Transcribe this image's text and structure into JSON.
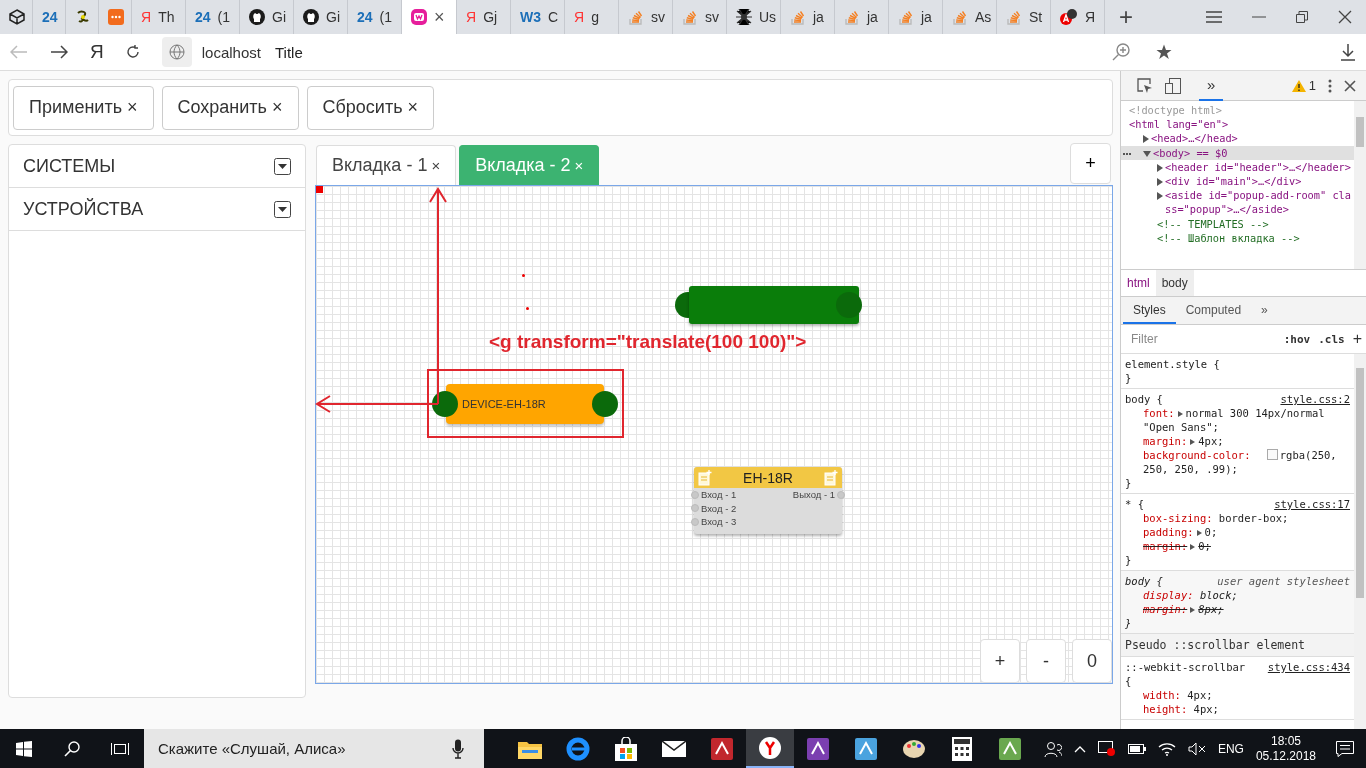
{
  "browser": {
    "tabs": [
      {
        "kind": "cube",
        "selected": false
      },
      {
        "kind": "logo",
        "logo": "24",
        "selected": false
      },
      {
        "kind": "bolt",
        "selected": false
      },
      {
        "kind": "dots",
        "selected": false
      },
      {
        "kind": "logo-red",
        "logo": "Я",
        "title": "Th",
        "selected": false
      },
      {
        "kind": "logo",
        "logo": "24",
        "title": "(1",
        "selected": false
      },
      {
        "kind": "github",
        "title": "Gi",
        "selected": false
      },
      {
        "kind": "github",
        "title": "Gi",
        "selected": false
      },
      {
        "kind": "logo",
        "logo": "24",
        "title": "(1",
        "selected": false
      },
      {
        "kind": "pink",
        "close": "×",
        "selected": true
      },
      {
        "kind": "logo-red",
        "logo": "Я",
        "title": "Gj",
        "selected": false
      },
      {
        "kind": "logo",
        "logo": "W3",
        "title": "C",
        "selected": false
      },
      {
        "kind": "logo-red",
        "logo": "Я",
        "title": "g",
        "selected": false
      },
      {
        "kind": "stack",
        "title": "sv",
        "selected": false
      },
      {
        "kind": "stack",
        "title": "sv",
        "selected": false
      },
      {
        "kind": "spider",
        "title": "Us",
        "selected": false
      },
      {
        "kind": "stack",
        "title": "ja",
        "selected": false
      },
      {
        "kind": "stack",
        "title": "ja",
        "selected": false
      },
      {
        "kind": "stack",
        "title": "ja",
        "selected": false
      },
      {
        "kind": "stack",
        "title": "As",
        "selected": false
      },
      {
        "kind": "stack",
        "title": "St",
        "selected": false
      },
      {
        "kind": "badge",
        "title": "Я",
        "selected": false
      }
    ],
    "new_tab": "+",
    "home": "Я",
    "address": {
      "host": "localhost",
      "title": "Title"
    }
  },
  "app": {
    "toolbar": [
      {
        "label": "Применить",
        "close": "×"
      },
      {
        "label": "Сохранить",
        "close": "×"
      },
      {
        "label": "Сбросить",
        "close": "×"
      }
    ],
    "sidebar": [
      {
        "label": "СИСТЕМЫ",
        "expanded": false
      },
      {
        "label": "УСТРОЙСТВА",
        "expanded": false
      }
    ],
    "tabs": [
      {
        "label": "Вкладка - 1",
        "close": "×",
        "selected": false
      },
      {
        "label": "Вкладка - 2",
        "close": "×",
        "selected": true
      }
    ],
    "add_tab": "+",
    "canvas": {
      "annotation": "<g transform=\"translate(100 100)\">",
      "device_node": "DEVICE-EH-18R",
      "block": {
        "title": "EH-18R",
        "inputs": [
          "Вход - 1",
          "Вход - 2",
          "Вход - 3"
        ],
        "outputs": [
          "Выход - 1"
        ]
      }
    },
    "zoom_buttons": [
      "+",
      "-",
      "0"
    ]
  },
  "devtools": {
    "panel_tab": "»",
    "warnings": "1",
    "tree": [
      {
        "text": "<!doctype html>",
        "kind": "doctype"
      },
      {
        "text": "<html lang=\"en\">",
        "kind": "tag",
        "children": [
          {
            "text": "<head>…</head>",
            "kind": "tag",
            "expanded": false,
            "selected": false
          },
          {
            "text": "<body> == $0",
            "kind": "tag",
            "expanded": true,
            "selected": true,
            "children": [
              {
                "text": "<header id=\"header\">…</header>",
                "kind": "tag",
                "expanded": false,
                "selected": false
              },
              {
                "text": "<div id=\"main\">…</div>",
                "kind": "tag",
                "expanded": false,
                "selected": false
              },
              {
                "text": "<aside id=\"popup-add-room\" class=\"popup\">…</aside>",
                "kind": "tag",
                "expanded": false,
                "selected": false
              },
              {
                "text": "<!-- TEMPLATES -->",
                "kind": "comment"
              },
              {
                "text": "<!-- Шаблон вкладка -->",
                "kind": "comment"
              }
            ]
          }
        ]
      }
    ],
    "breadcrumbs": [
      {
        "label": "html",
        "selected": false
      },
      {
        "label": "body",
        "selected": true
      }
    ],
    "style_tabs": [
      {
        "label": "Styles",
        "selected": true
      },
      {
        "label": "Computed",
        "selected": false
      },
      {
        "label": "»",
        "selected": false
      }
    ],
    "filter": {
      "placeholder": "Filter"
    },
    "hov": ":hov",
    "cls": ".cls",
    "add_rule": "+",
    "rules": [
      {
        "kind": "inline",
        "selector": "element.style {",
        "close": "}"
      },
      {
        "kind": "author",
        "selector": "body {",
        "source": "style.css:2",
        "close": "}",
        "declarations": [
          {
            "kind": "plain",
            "property": "font:",
            "value": "normal 300 14px/normal \"Open Sans\";",
            "expandable": true,
            "struck": false
          },
          {
            "kind": "plain",
            "property": "margin:",
            "value": "4px;",
            "expandable": true,
            "struck": false
          },
          {
            "kind": "color",
            "property": "background-color:",
            "value": "rgba(250, 250, 250, .99);",
            "expandable": false,
            "struck": false
          }
        ]
      },
      {
        "kind": "author",
        "selector": "* {",
        "source": "style.css:17",
        "close": "}",
        "declarations": [
          {
            "kind": "plain",
            "property": "box-sizing:",
            "value": "border-box;",
            "expandable": false,
            "struck": false
          },
          {
            "kind": "plain",
            "property": "padding:",
            "value": "0;",
            "expandable": true,
            "struck": false
          },
          {
            "kind": "plain",
            "property": "margin:",
            "value": "0;",
            "expandable": true,
            "struck": true
          }
        ]
      },
      {
        "kind": "agent",
        "selector": "body {",
        "source": "user agent stylesheet",
        "close": "}",
        "declarations": [
          {
            "kind": "plain",
            "property": "display:",
            "value": "block;",
            "expandable": false,
            "struck": false
          },
          {
            "kind": "plain",
            "property": "margin:",
            "value": "8px;",
            "expandable": true,
            "struck": true
          }
        ]
      },
      {
        "kind": "header",
        "selector": "Pseudo ::scrollbar element"
      },
      {
        "kind": "author",
        "selector": "::-webkit-scrollbar",
        "source": "style.css:434",
        "brace_line": "{",
        "declarations": [
          {
            "kind": "plain",
            "property": "width:",
            "value": "4px;",
            "expandable": false,
            "struck": false
          },
          {
            "kind": "plain",
            "property": "height:",
            "value": "4px;",
            "expandable": false,
            "struck": false
          }
        ]
      }
    ]
  },
  "taskbar": {
    "search_placeholder": "Скажите «Слушай, Алиса»",
    "apps": [
      {
        "kind": "folder",
        "selected": false
      },
      {
        "kind": "ring",
        "selected": false
      },
      {
        "kind": "bag",
        "selected": false
      },
      {
        "kind": "envelope",
        "selected": false
      },
      {
        "kind": "tile",
        "color": "#c1272d",
        "selected": false
      },
      {
        "kind": "circle",
        "selected": true
      },
      {
        "kind": "tile",
        "color": "#7b3fb0",
        "selected": false
      },
      {
        "kind": "tile",
        "color": "#4aa3df",
        "selected": false
      },
      {
        "kind": "palette",
        "selected": false
      },
      {
        "kind": "calculator",
        "selected": false
      },
      {
        "kind": "tile",
        "color": "#6aa84f",
        "selected": false
      }
    ],
    "language": "ENG",
    "time": "18:05",
    "date": "05.12.2018"
  }
}
